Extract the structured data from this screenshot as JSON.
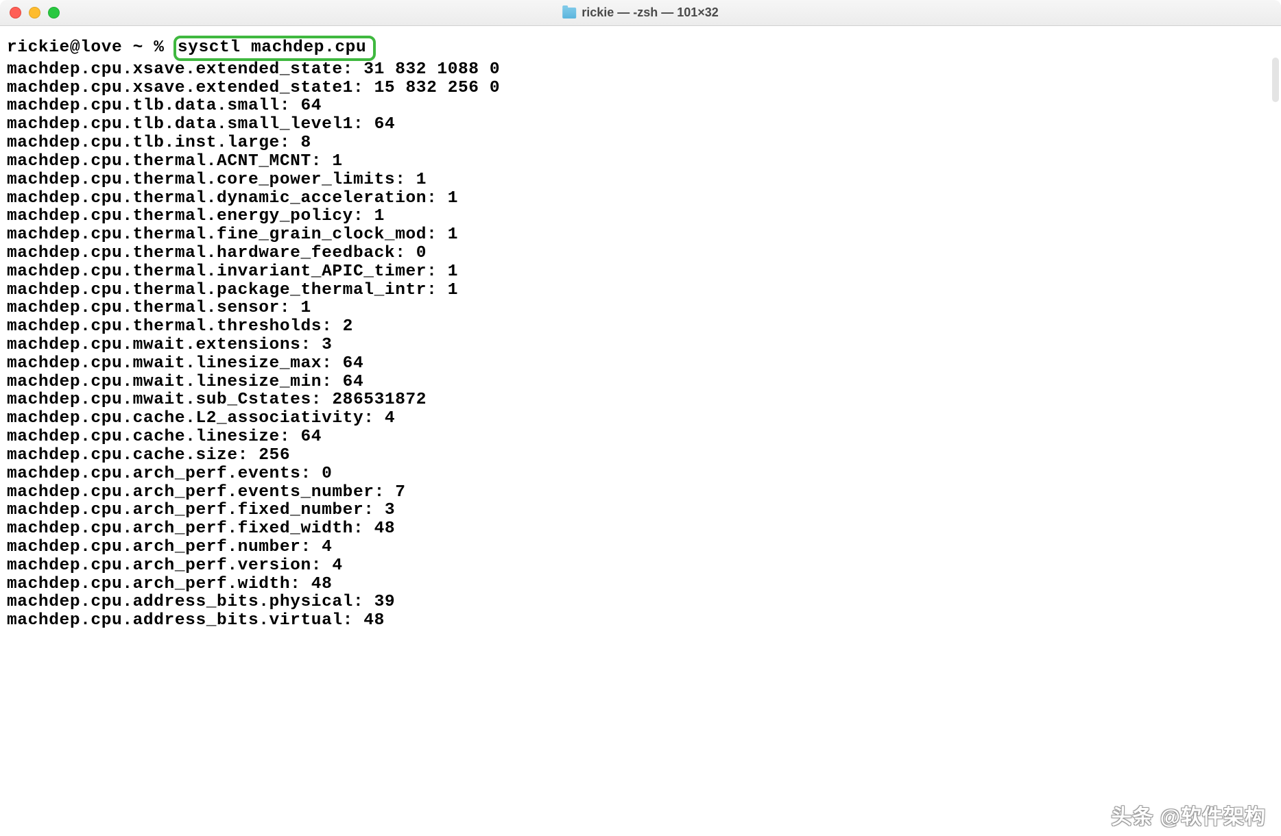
{
  "window": {
    "title": "rickie — -zsh — 101×32"
  },
  "terminal": {
    "prompt": "rickie@love ~ % ",
    "command": "sysctl machdep.cpu",
    "output": [
      "machdep.cpu.xsave.extended_state: 31 832 1088 0",
      "machdep.cpu.xsave.extended_state1: 15 832 256 0",
      "machdep.cpu.tlb.data.small: 64",
      "machdep.cpu.tlb.data.small_level1: 64",
      "machdep.cpu.tlb.inst.large: 8",
      "machdep.cpu.thermal.ACNT_MCNT: 1",
      "machdep.cpu.thermal.core_power_limits: 1",
      "machdep.cpu.thermal.dynamic_acceleration: 1",
      "machdep.cpu.thermal.energy_policy: 1",
      "machdep.cpu.thermal.fine_grain_clock_mod: 1",
      "machdep.cpu.thermal.hardware_feedback: 0",
      "machdep.cpu.thermal.invariant_APIC_timer: 1",
      "machdep.cpu.thermal.package_thermal_intr: 1",
      "machdep.cpu.thermal.sensor: 1",
      "machdep.cpu.thermal.thresholds: 2",
      "machdep.cpu.mwait.extensions: 3",
      "machdep.cpu.mwait.linesize_max: 64",
      "machdep.cpu.mwait.linesize_min: 64",
      "machdep.cpu.mwait.sub_Cstates: 286531872",
      "machdep.cpu.cache.L2_associativity: 4",
      "machdep.cpu.cache.linesize: 64",
      "machdep.cpu.cache.size: 256",
      "machdep.cpu.arch_perf.events: 0",
      "machdep.cpu.arch_perf.events_number: 7",
      "machdep.cpu.arch_perf.fixed_number: 3",
      "machdep.cpu.arch_perf.fixed_width: 48",
      "machdep.cpu.arch_perf.number: 4",
      "machdep.cpu.arch_perf.version: 4",
      "machdep.cpu.arch_perf.width: 48",
      "machdep.cpu.address_bits.physical: 39",
      "machdep.cpu.address_bits.virtual: 48"
    ]
  },
  "watermark": "头条 @软件架构"
}
